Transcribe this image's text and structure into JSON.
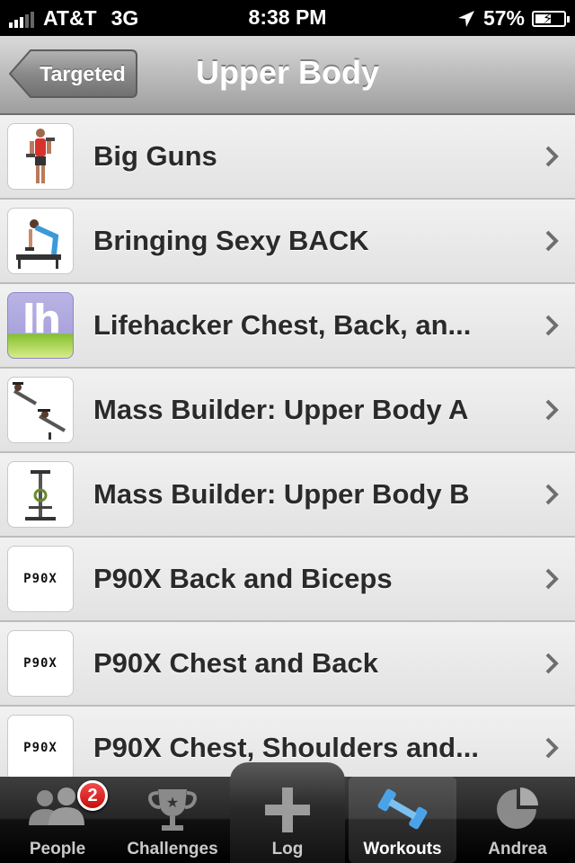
{
  "status": {
    "carrier": "AT&T",
    "network": "3G",
    "time": "8:38 PM",
    "battery": "57%",
    "battery_level": 0.57
  },
  "navbar": {
    "back_label": "Targeted",
    "title": "Upper Body"
  },
  "workouts": [
    {
      "label": "Big Guns",
      "thumb": "dumbbell-curl-photo"
    },
    {
      "label": "Bringing Sexy BACK",
      "thumb": "bench-row-photo"
    },
    {
      "label": "Lifehacker Chest, Back, an...",
      "thumb": "lifehacker-logo",
      "logo_text": "lh"
    },
    {
      "label": "Mass Builder: Upper Body A",
      "thumb": "bench-press-photo"
    },
    {
      "label": "Mass Builder: Upper Body B",
      "thumb": "machine-photo"
    },
    {
      "label": "P90X Back and Biceps",
      "thumb": "p90x-logo",
      "logo_text": "P90X"
    },
    {
      "label": "P90X Chest and Back",
      "thumb": "p90x-logo",
      "logo_text": "P90X"
    },
    {
      "label": "P90X Chest, Shoulders and...",
      "thumb": "p90x-logo",
      "logo_text": "P90X"
    }
  ],
  "tabs": [
    {
      "label": "People",
      "icon": "people-icon",
      "badge": "2"
    },
    {
      "label": "Challenges",
      "icon": "trophy-icon"
    },
    {
      "label": "Log",
      "icon": "plus-icon"
    },
    {
      "label": "Workouts",
      "icon": "dumbbell-icon",
      "selected": true
    },
    {
      "label": "Andrea",
      "icon": "pie-chart-icon"
    }
  ],
  "colors": {
    "nav_gradient_top": "#d9d9d9",
    "nav_gradient_bottom": "#9e9e9e",
    "badge_red": "#e02020",
    "dumbbell_blue": "#4aa3e8"
  }
}
